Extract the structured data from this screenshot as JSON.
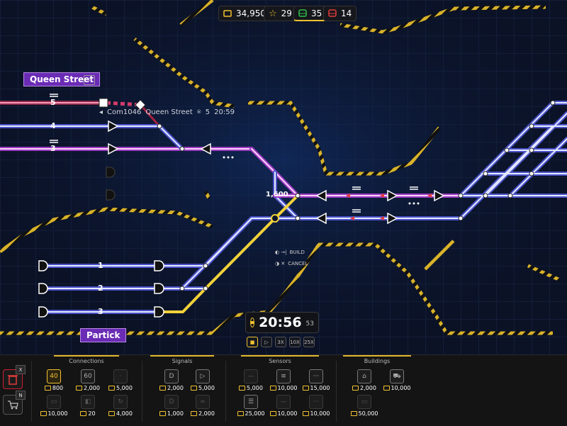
{
  "hud": {
    "money": "34,950",
    "stars": "29",
    "trains_ok": "35",
    "trains_late": "14",
    "colors": {
      "star": "#f2c230",
      "ok": "#2fbf4a",
      "late": "#e53b3b",
      "money": "#f2c230"
    }
  },
  "stations": {
    "queen_street": "Queen Street",
    "partick": "Partick"
  },
  "train_info": {
    "id": "Com1046",
    "destination": "Queen Street",
    "platform": "5",
    "time": "20:59"
  },
  "tracks": {
    "queen": [
      "5",
      "4",
      "3"
    ],
    "partick": [
      "1",
      "2",
      "3"
    ]
  },
  "distance_label": "1,600",
  "hints": {
    "build": "BUILD",
    "cancel": "CANCEL"
  },
  "clock": {
    "time": "20:56",
    "seconds": "53"
  },
  "speeds": [
    "■",
    "▷",
    "3X",
    "10X",
    "25X"
  ],
  "panel": {
    "side_keys": [
      "X",
      "N"
    ],
    "categories": [
      {
        "title": "Connections",
        "items": [
          {
            "icon": "40",
            "cost": "800"
          },
          {
            "icon": "60",
            "cost": "2,000"
          },
          {
            "icon": "·",
            "cost": "5,000"
          },
          {
            "icon": "▭",
            "cost": "10,000"
          },
          {
            "icon": "◧",
            "cost": "20"
          },
          {
            "icon": "↻",
            "cost": "4,000"
          }
        ]
      },
      {
        "title": "Signals",
        "items": [
          {
            "icon": "D",
            "cost": "2,000"
          },
          {
            "icon": "▷",
            "cost": "5,000"
          },
          {
            "icon": "D",
            "cost": "1,000"
          },
          {
            "icon": "∞",
            "cost": "2,000"
          }
        ]
      },
      {
        "title": "Sensors",
        "items": [
          {
            "icon": "—",
            "cost": "5,000"
          },
          {
            "icon": "≡",
            "cost": "10,000"
          },
          {
            "icon": "···",
            "cost": "15,000"
          },
          {
            "icon": "☰",
            "cost": "25,000"
          },
          {
            "icon": "—",
            "cost": "10,000"
          },
          {
            "icon": "···",
            "cost": "10,000"
          }
        ]
      },
      {
        "title": "Buildings",
        "items": [
          {
            "icon": "⌂",
            "cost": "2,000"
          },
          {
            "icon": "⛟",
            "cost": "10,000"
          },
          {
            "icon": "▭",
            "cost": "50,000"
          }
        ]
      }
    ]
  }
}
